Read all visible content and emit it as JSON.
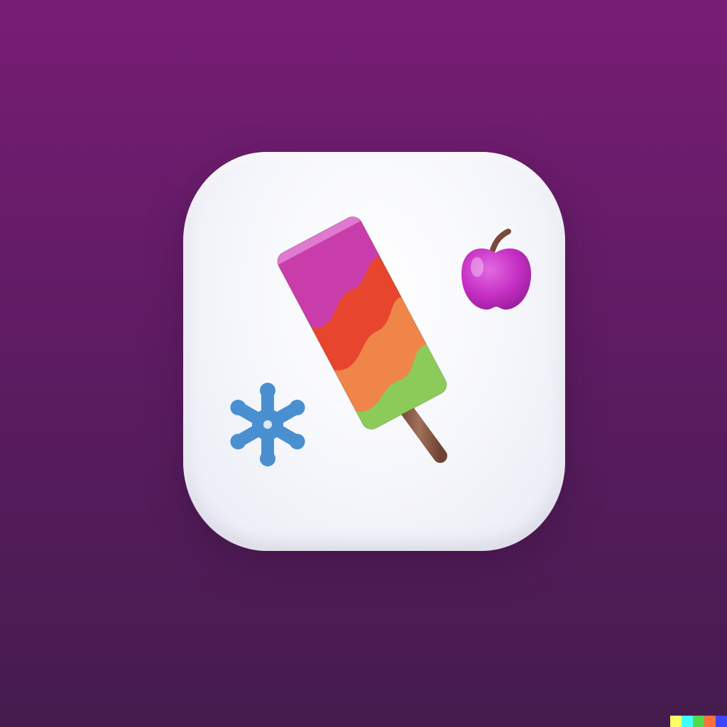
{
  "image": {
    "subject": "popsicle-app-icon",
    "background_colors": {
      "top": "#781d75",
      "bottom": "#451c4e"
    },
    "tile_color": "#f7f8fc"
  },
  "icons": {
    "popsicle": {
      "name": "popsicle-icon",
      "layer_colors": [
        "#c93dab",
        "#e8452e",
        "#f0854a",
        "#8ccb5a"
      ],
      "stick_color": "#8a5a44"
    },
    "apple": {
      "name": "apple-icon",
      "color": "#c62fc4",
      "stem_color": "#7a4a3a"
    },
    "snowflake": {
      "name": "snowflake-icon",
      "color": "#4a90d0"
    }
  },
  "watermark": {
    "colors": [
      "#ffff66",
      "#42ffff",
      "#51da4c",
      "#ff6e3c",
      "#3c46ff"
    ]
  }
}
